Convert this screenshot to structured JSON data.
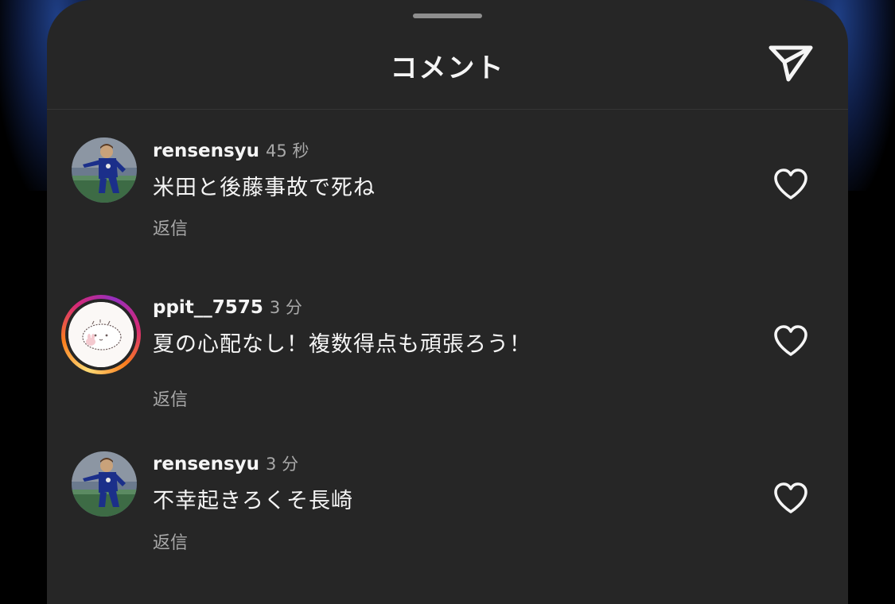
{
  "header": {
    "title": "コメント",
    "share_icon": "send-icon"
  },
  "comments": [
    {
      "username": "rensensyu",
      "time": "45 秒",
      "text": "米田と後藤事故で死ね",
      "reply_label": "返信",
      "has_story": false
    },
    {
      "username": "ppit__7575",
      "time": "3 分",
      "text": "夏の心配なし！複数得点も頑張ろう！",
      "reply_label": "返信",
      "has_story": true
    },
    {
      "username": "rensensyu",
      "time": "3 分",
      "text": "不幸起きろくそ長崎",
      "reply_label": "返信",
      "has_story": false
    }
  ],
  "icons": {
    "like": "heart-outline-icon",
    "share": "send-icon"
  },
  "colors": {
    "sheet_background": "#262626",
    "primary_text": "#f5f5f5",
    "secondary_text": "#a8a8a8",
    "story_ring_start": "#feda75",
    "story_ring_end": "#962fbf"
  }
}
